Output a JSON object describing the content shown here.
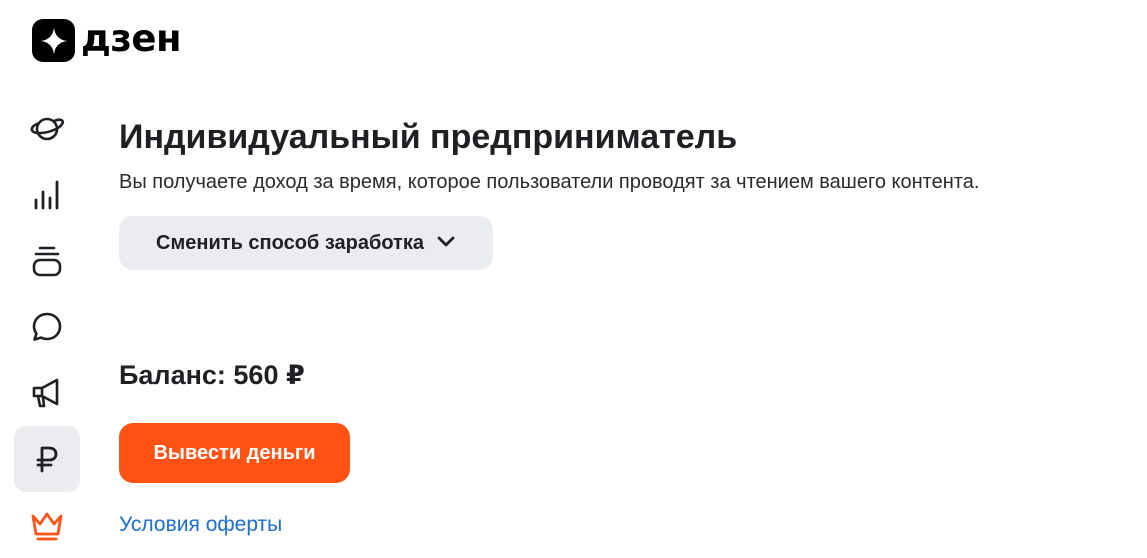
{
  "brand": {
    "name": "дзен",
    "logo_icon": "zen-star-icon"
  },
  "sidebar": {
    "items": [
      {
        "icon": "planet-icon",
        "active": false
      },
      {
        "icon": "stats-bars-icon",
        "active": false
      },
      {
        "icon": "stack-layers-icon",
        "active": false
      },
      {
        "icon": "comment-bubble-icon",
        "active": false
      },
      {
        "icon": "megaphone-icon",
        "active": false
      },
      {
        "icon": "ruble-icon",
        "active": true
      },
      {
        "icon": "crown-icon",
        "active": false
      }
    ],
    "active_color": "#ebecf0",
    "crown_color": "#ff5214"
  },
  "main": {
    "title": "Индивидуальный предприниматель",
    "subtitle": "Вы получаете доход за время, которое пользователи проводят за чтением вашего контента.",
    "change_button_label": "Сменить способ заработка",
    "balance_text": "Баланс: 560 ₽",
    "withdraw_button_label": "Вывести деньги",
    "offer_link_label": "Условия оферты"
  },
  "colors": {
    "accent": "#ff5214",
    "link": "#1a6ed8",
    "text": "#1f2024",
    "button_bg": "#ebecf0"
  }
}
